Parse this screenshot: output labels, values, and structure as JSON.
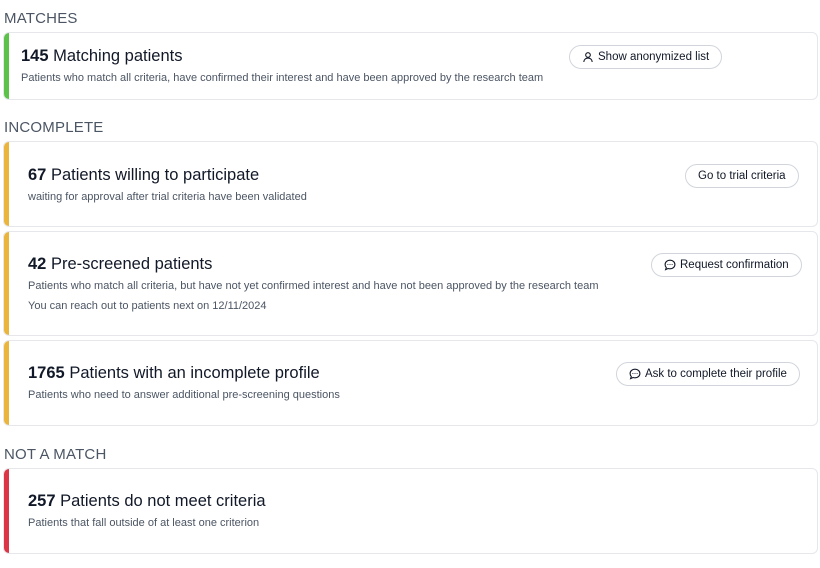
{
  "sections": {
    "matches": "MATCHES",
    "incomplete": "INCOMPLETE",
    "not_a_match": "NOT A MATCH"
  },
  "cards": {
    "matching": {
      "count": "145",
      "title": "Matching patients",
      "description": "Patients who match all criteria, have confirmed their interest and have been approved by the research team",
      "button_label": "Show anonymized list",
      "button_icon": "user-icon",
      "accent": "#5cc24a"
    },
    "willing": {
      "count": "67",
      "title": "Patients willing to participate",
      "description": "waiting for approval after trial criteria have been validated",
      "button_label": "Go to trial criteria",
      "accent": "#ebb43a"
    },
    "prescreened": {
      "count": "42",
      "title": "Pre-screened patients",
      "description": "Patients who match all criteria, but have not yet confirmed interest and have not been approved by the research team",
      "note": "You can reach out to patients next on 12/11/2024",
      "button_label": "Request confirmation",
      "button_icon": "chat-bubble-icon",
      "accent": "#ebb43a"
    },
    "incomplete_profile": {
      "count": "1765",
      "title": "Patients with an incomplete profile",
      "description": "Patients who need to answer additional pre-screening questions",
      "button_label": "Ask to complete their profile",
      "button_icon": "chat-bubble-icon",
      "accent": "#ebb43a"
    },
    "not_meet": {
      "count": "257",
      "title": "Patients do not meet criteria",
      "description": "Patients that fall outside of at least one criterion",
      "accent": "#dc3545"
    }
  }
}
